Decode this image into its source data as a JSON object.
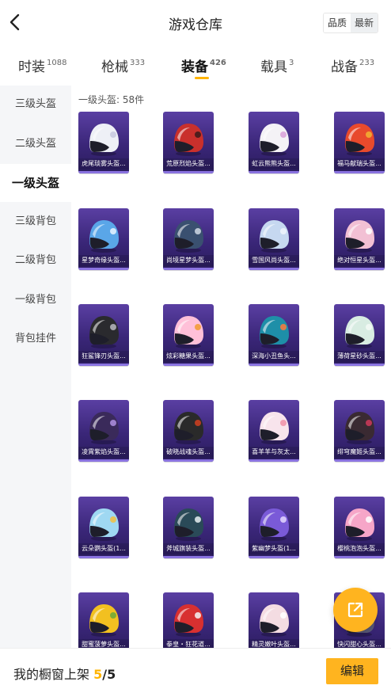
{
  "header": {
    "title": "游戏仓库",
    "back_icon": "chevron-left-icon"
  },
  "sort": {
    "options": [
      "品质",
      "最新"
    ],
    "selected": "品质"
  },
  "tabs": [
    {
      "label": "时装",
      "count": "1088"
    },
    {
      "label": "枪械",
      "count": "333"
    },
    {
      "label": "装备",
      "count": "426",
      "active": true
    },
    {
      "label": "载具",
      "count": "3"
    },
    {
      "label": "战备",
      "count": "233"
    }
  ],
  "sidebar": {
    "items": [
      {
        "label": "三级头盔"
      },
      {
        "label": "二级头盔"
      },
      {
        "label": "一级头盔",
        "active": true
      },
      {
        "label": "三级背包"
      },
      {
        "label": "二级背包"
      },
      {
        "label": "一级背包"
      },
      {
        "label": "背包挂件"
      }
    ]
  },
  "section": {
    "label": "一级头盔: 58件"
  },
  "items": [
    {
      "name": "虎尾琰雾头盔...",
      "color": "#eef0f6",
      "accent": "#c7c9de"
    },
    {
      "name": "荒原烈焰头盔...",
      "color": "#c9302c",
      "accent": "#3a1a1a"
    },
    {
      "name": "虹云熊熊头盔...",
      "color": "#f4f2f6",
      "accent": "#d8a0d8"
    },
    {
      "name": "福马献瑞头盔...",
      "color": "#e84a2c",
      "accent": "#f2b233"
    },
    {
      "name": "星梦奇缘头盔...",
      "color": "#5aa6e8",
      "accent": "#e9f3ff"
    },
    {
      "name": "尚境星梦头盔...",
      "color": "#3a5070",
      "accent": "#d0d8e4"
    },
    {
      "name": "雪国风尚头盔...",
      "color": "#c6d8f0",
      "accent": "#eef4fb"
    },
    {
      "name": "绝对恒星头盔...",
      "color": "#f2c0d4",
      "accent": "#ffffff"
    },
    {
      "name": "狂鲨锋刃头盔...",
      "color": "#2a2a2e",
      "accent": "#b8b8c0"
    },
    {
      "name": "炫彩糖果头盔...",
      "color": "#ffc0d8",
      "accent": "#f29a2e"
    },
    {
      "name": "深海小丑鱼头...",
      "color": "#1e8fa8",
      "accent": "#ff7a3a"
    },
    {
      "name": "薄荷星砂头盔...",
      "color": "#d8ece2",
      "accent": "#f4faf6"
    },
    {
      "name": "凌霄紫焰头盔...",
      "color": "#3a2a5a",
      "accent": "#b090e0"
    },
    {
      "name": "破晓战魂头盔...",
      "color": "#2a2a2a",
      "accent": "#d04020"
    },
    {
      "name": "喜羊羊与灰太...",
      "color": "#f8e4ec",
      "accent": "#f090a8"
    },
    {
      "name": "绯穹魔姬头盔...",
      "color": "#3a2a32",
      "accent": "#d03a5a"
    },
    {
      "name": "云朵鹦头盔(1...",
      "color": "#9fd8f2",
      "accent": "#f2c040"
    },
    {
      "name": "斧城旗装头盔...",
      "color": "#2a4a58",
      "accent": "#e8f0f2"
    },
    {
      "name": "紫幽梦头盔(1...",
      "color": "#7a5ad8",
      "accent": "#e4d8ff"
    },
    {
      "name": "樱桃泡泡头盔...",
      "color": "#f6a6c8",
      "accent": "#ffffff"
    },
    {
      "name": "甜蜜菠萝头盔...",
      "color": "#f2c020",
      "accent": "#6aa83a"
    },
    {
      "name": "拳皇・狂花道...",
      "color": "#d83030",
      "accent": "#f4f4f4"
    },
    {
      "name": "精灵嫩叶头盔...",
      "color": "#f4dce2",
      "accent": "#ffffff"
    },
    {
      "name": "快闪甜心头盔...",
      "color": "#5a5a78",
      "accent": "#f2a8c4"
    }
  ],
  "fab": {
    "icon": "share-icon"
  },
  "footer": {
    "text": "我的橱窗上架",
    "current": "5",
    "total": "/5",
    "button_label": "编辑"
  }
}
